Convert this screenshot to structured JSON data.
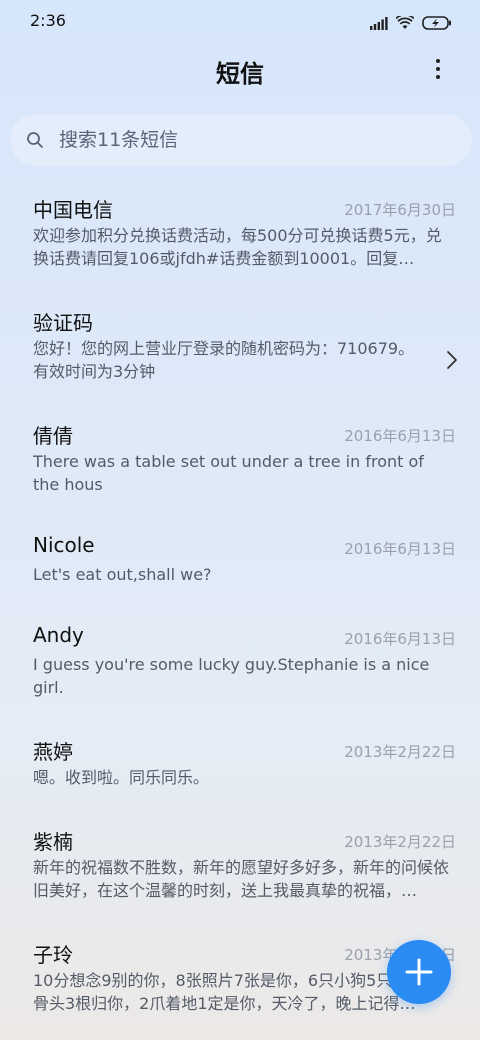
{
  "status_bar": {
    "time": "2:36",
    "icons": [
      "signal-icon",
      "wifi-icon",
      "battery-charging-icon"
    ]
  },
  "header": {
    "title": "短信",
    "more_icon": "more-vertical-icon"
  },
  "search": {
    "placeholder": "搜索11条短信",
    "icon": "search-icon"
  },
  "threads": [
    {
      "name": "中国电信",
      "date": "2017年6月30日",
      "preview": "欢迎参加积分兑换话费活动，每500分可兑换话费5元，兑换话费请回复106或jfdh#话费金额到10001。回复…"
    },
    {
      "name": "验证码",
      "date": "",
      "preview": "您好！您的网上营业厅登录的随机密码为：710679。有效时间为3分钟"
    },
    {
      "name": "倩倩",
      "date": "2016年6月13日",
      "preview": "There was a table set out under a tree in front of the hous"
    },
    {
      "name": "Nicole",
      "date": "2016年6月13日",
      "preview": "Let's eat out,shall we?"
    },
    {
      "name": "Andy",
      "date": "2016年6月13日",
      "preview": "I guess you're some lucky guy.Stephanie is a nice girl."
    },
    {
      "name": "燕婷",
      "date": "2013年2月22日",
      "preview": "嗯。收到啦。同乐同乐。"
    },
    {
      "name": "紫楠",
      "date": "2013年2月22日",
      "preview": "新年的祝福数不胜数，新年的愿望好多好多，新年的问候依旧美好，在这个温馨的时刻，送上我最真挚的祝福，…"
    },
    {
      "name": "子玲",
      "date": "2013年2月22日",
      "preview": "10分想念9别的你，8张照片7张是你，6只小狗5只，4根骨头3根归你，2爪着地1定是你，天冷了，晚上记得…"
    }
  ],
  "fab": {
    "icon": "plus-icon"
  },
  "colors": {
    "accent": "#2a8cf3",
    "date": "#9aa1ad",
    "preview": "#545b67"
  }
}
